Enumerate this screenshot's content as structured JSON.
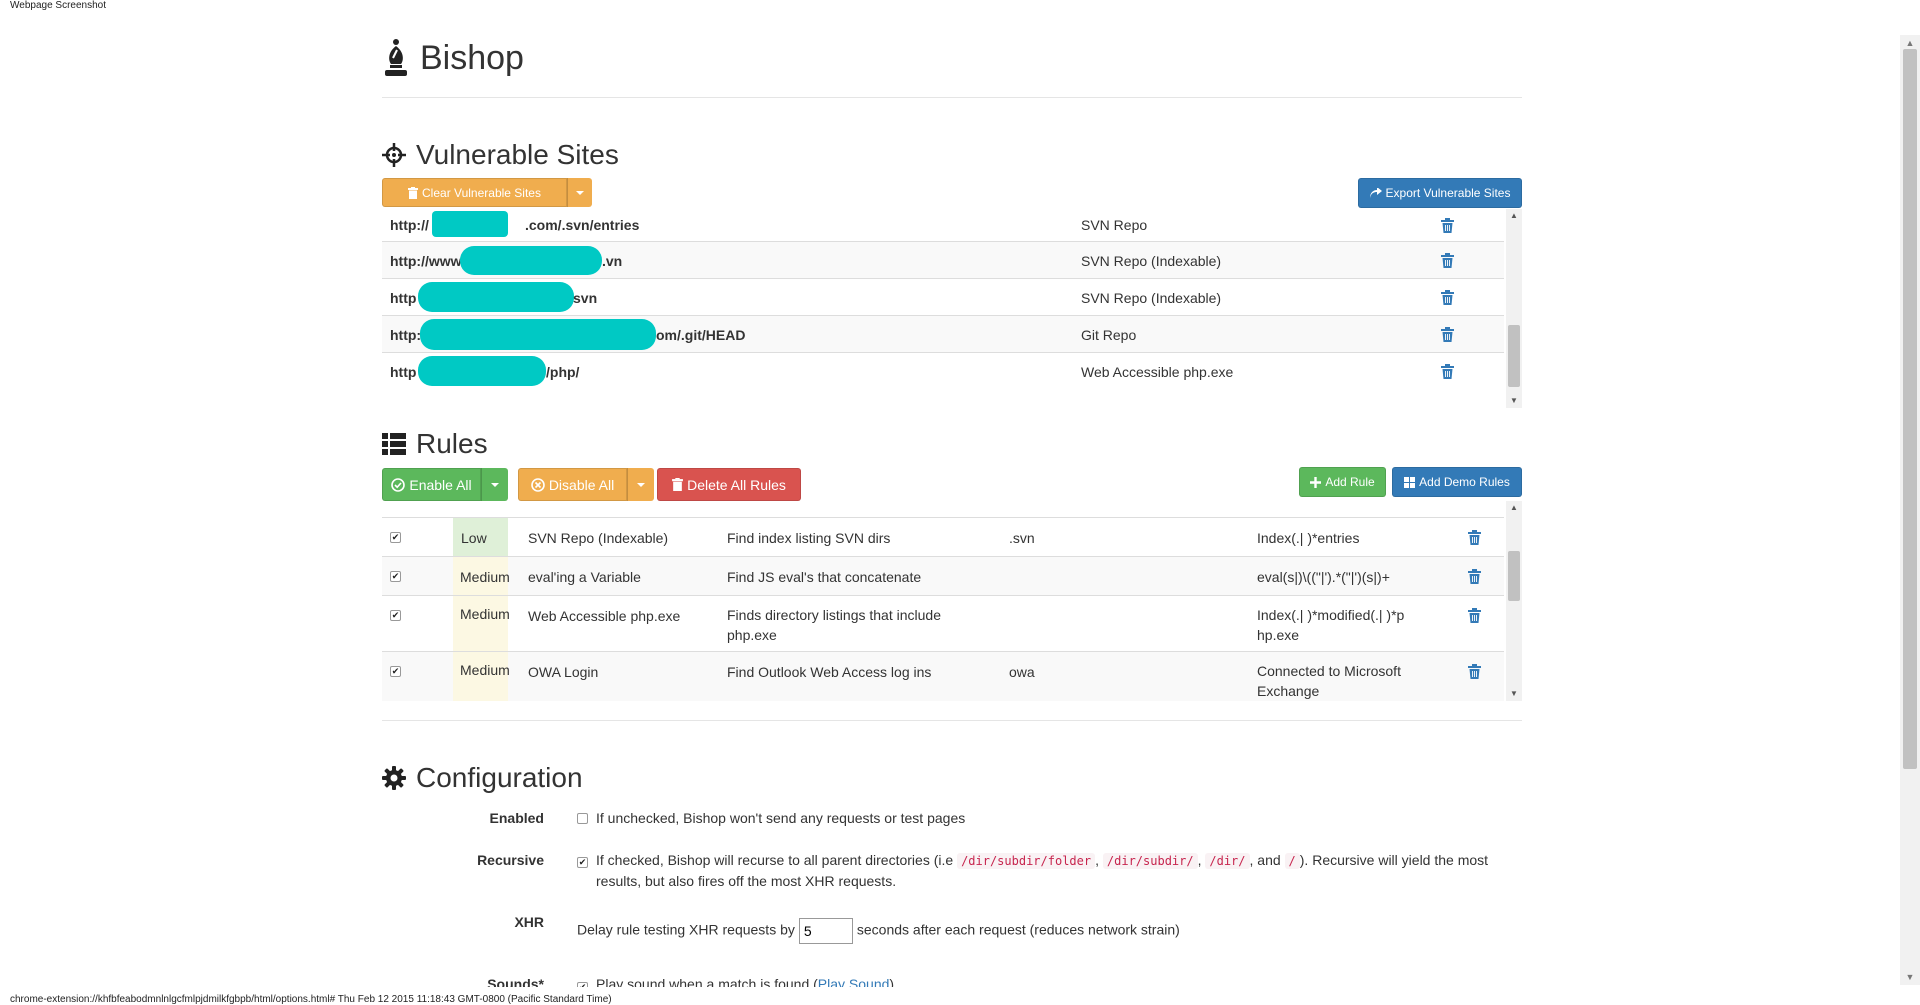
{
  "browser": {
    "screenshot_label": "Webpage Screenshot",
    "status_line": "chrome-extension://khfbfeabodmnlnlgcfmlpjdmilkfgbpb/html/options.html# Thu Feb 12 2015 11:18:43 GMT-0800 (Pacific Standard Time)"
  },
  "app": {
    "title": "Bishop",
    "icon": "chess-bishop-icon"
  },
  "vulnerable_sites": {
    "heading": "Vulnerable Sites",
    "clear_label": "Clear Vulnerable Sites",
    "export_label": "Export Vulnerable Sites",
    "rows": [
      {
        "url_start": "http://",
        "url_end": ".com/.svn/entries",
        "type": "SVN Repo"
      },
      {
        "url_start": "http://www",
        "url_end": ".vn",
        "type": "SVN Repo (Indexable)"
      },
      {
        "url_start": "http",
        "url_end": "svn",
        "type": "SVN Repo (Indexable)"
      },
      {
        "url_start": "http:",
        "url_end": "om/.git/HEAD",
        "type": "Git Repo"
      },
      {
        "url_start": "http",
        "url_end": "/php/",
        "type": "Web Accessible php.exe"
      }
    ]
  },
  "rules": {
    "heading": "Rules",
    "enable_all": "Enable All",
    "disable_all": "Disable All",
    "delete_all": "Delete All Rules",
    "add_rule": "Add Rule",
    "add_demo": "Add Demo Rules",
    "rows": [
      {
        "enabled": true,
        "severity": "Low",
        "name": "SVN Repo (Indexable)",
        "description": "Find index listing SVN dirs",
        "url": ".svn",
        "match": "Index(.| )*entries"
      },
      {
        "enabled": true,
        "severity": "Medium",
        "name": "eval'ing a Variable",
        "description": "Find JS eval's that concatenate",
        "url": "",
        "match": "eval(s|)\\((\"|').*(\"|')(s|)+"
      },
      {
        "enabled": true,
        "severity": "Medium",
        "name": "Web Accessible php.exe",
        "description": "Finds directory listings that include php.exe",
        "url": "",
        "match": "Index(.| )*modified(.| )*php.exe"
      },
      {
        "enabled": true,
        "severity": "Medium",
        "name": "OWA Login",
        "description": "Find Outlook Web Access log ins",
        "url": "owa",
        "match": "Connected to Microsoft Exchange"
      }
    ]
  },
  "configuration": {
    "heading": "Configuration",
    "enabled": {
      "label": "Enabled",
      "checked": false,
      "text": "If unchecked, Bishop won't send any requests or test pages"
    },
    "recursive": {
      "label": "Recursive",
      "checked": true,
      "text_a": "If checked, Bishop will recurse to all parent directories (i.e",
      "code1": "/dir/subdir/folder",
      "code2": "/dir/subdir/",
      "code3": "/dir/",
      "and": ", and",
      "code4": "/",
      "text_b": "). Recursive will yield the most results, but also fires off the most XHR requests."
    },
    "xhr": {
      "label": "XHR",
      "text_before": "Delay rule testing XHR requests by",
      "value": "5",
      "text_after": "seconds after each request (reduces network strain)"
    },
    "sounds": {
      "label": "Sounds*",
      "checked": true,
      "text": "Play sound when a match is found (",
      "link": "Play Sound",
      "text_end": ")"
    }
  }
}
